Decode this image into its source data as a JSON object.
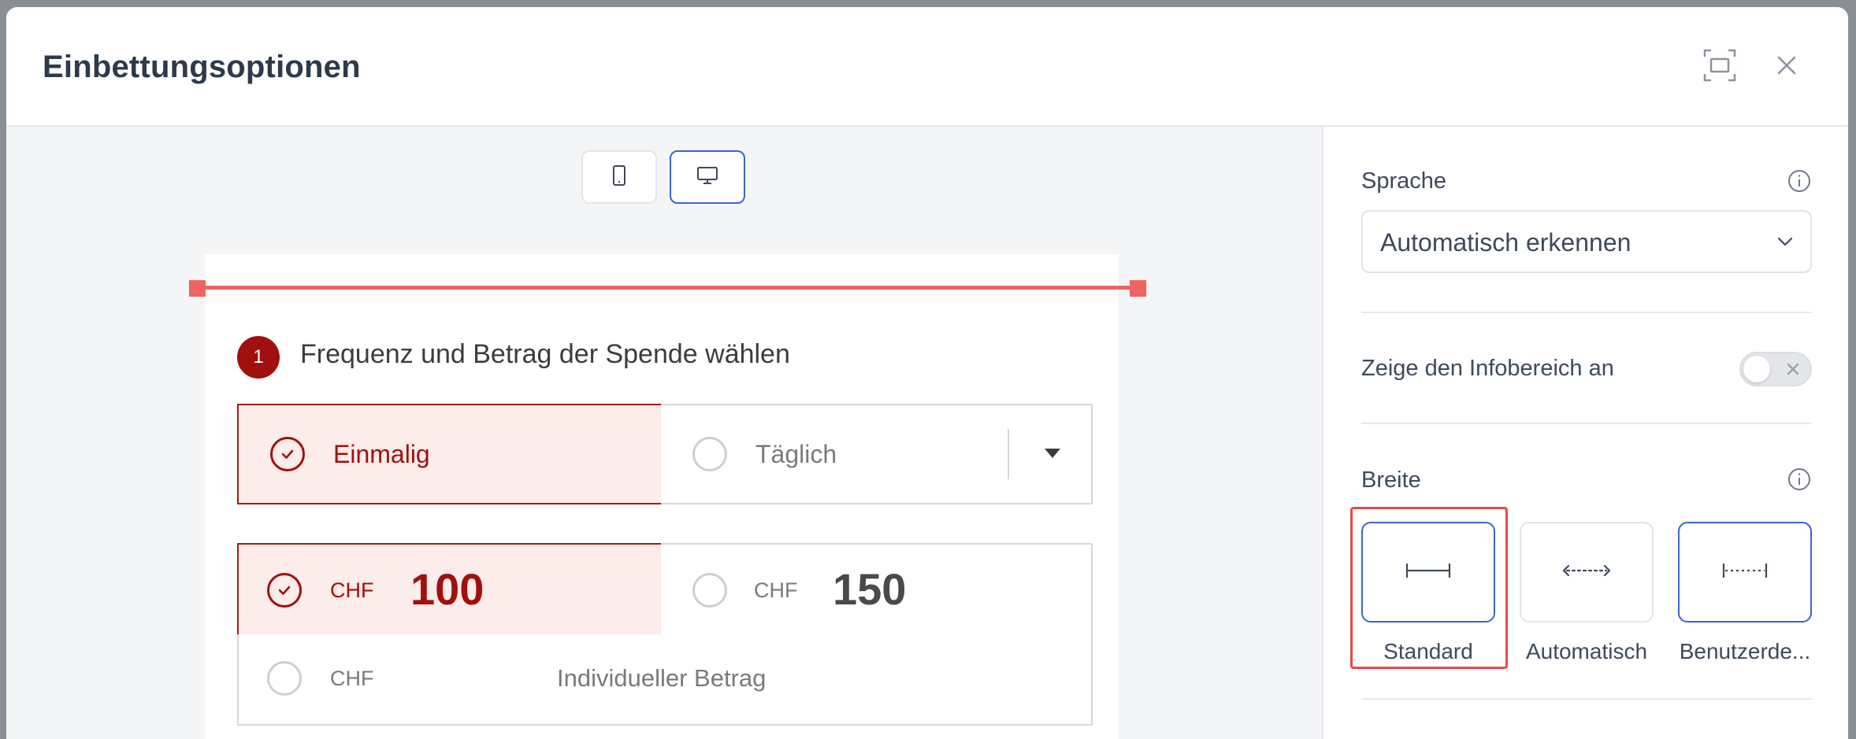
{
  "modal": {
    "title": "Einbettungsoptionen",
    "fullscreen_icon": "fullscreen-icon",
    "close_icon": "close-icon"
  },
  "preview": {
    "device_buttons": [
      {
        "icon": "mobile-icon",
        "active": false
      },
      {
        "icon": "desktop-icon",
        "active": true
      }
    ],
    "form": {
      "step_number": "1",
      "step_title": "Frequenz und Betrag der Spende wählen",
      "frequency": {
        "selected": "Einmalig",
        "other": "Täglich"
      },
      "amounts": [
        {
          "currency": "CHF",
          "value": "100",
          "selected": true
        },
        {
          "currency": "CHF",
          "value": "150",
          "selected": false
        }
      ],
      "custom_amount": {
        "currency": "CHF",
        "placeholder": "Individueller Betrag"
      }
    }
  },
  "settings": {
    "language": {
      "label": "Sprache",
      "value": "Automatisch erkennen"
    },
    "info_area": {
      "label": "Zeige den Infobereich an",
      "enabled": false
    },
    "width": {
      "label": "Breite",
      "options": [
        "Standard",
        "Automatisch",
        "Benutzerde..."
      ],
      "selected": "Standard"
    }
  },
  "colors": {
    "accent_red": "#a0110d",
    "selected_bg": "#fcecea",
    "blue_border": "#3d63d2",
    "highlight_red": "#ea4a45"
  }
}
